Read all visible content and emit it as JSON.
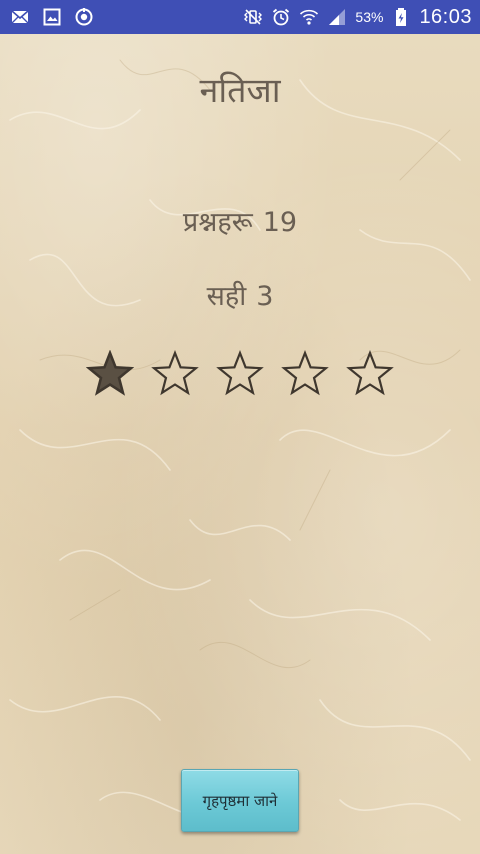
{
  "status_bar": {
    "battery_percent": "53%",
    "time": "16:03",
    "icons_left": [
      "email-icon",
      "image-icon",
      "sync-icon"
    ],
    "icons_right": [
      "vibrate-mute-icon",
      "alarm-icon",
      "wifi-icon",
      "signal-icon",
      "battery-charging-icon"
    ],
    "background_color": "#3f4fb5"
  },
  "result": {
    "title": "नतिजा",
    "questions_label": "प्रश्नहरू",
    "questions_count": "19",
    "correct_label": "सही",
    "correct_count": "3",
    "rating": {
      "filled": 1,
      "total": 5
    }
  },
  "home_button": {
    "label": "गृहपृष्ठमा जाने"
  },
  "colors": {
    "text": "#6a5f53",
    "button": "#6cc9d6",
    "star_fill": "#5a5043",
    "star_outline": "#3f372e"
  }
}
